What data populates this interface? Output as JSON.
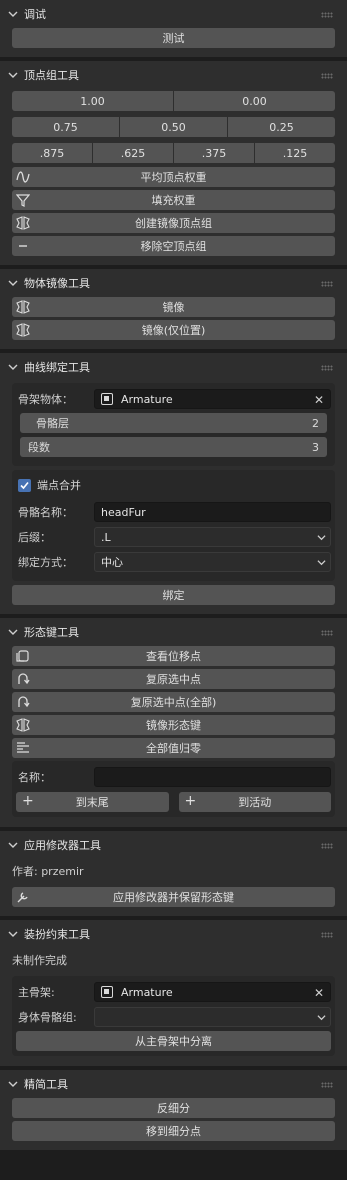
{
  "panels": {
    "debug": {
      "title": "调试",
      "test_label": "测试"
    },
    "vgroup": {
      "title": "顶点组工具",
      "row1": [
        "1.00",
        "0.00"
      ],
      "row2": [
        "0.75",
        "0.50",
        "0.25"
      ],
      "row3": [
        ".875",
        ".625",
        ".375",
        ".125"
      ],
      "avg_label": "平均顶点权重",
      "fill_label": "填充权重",
      "mirror_label": "创建镜像顶点组",
      "remove_label": "移除空顶点组"
    },
    "objmirror": {
      "title": "物体镜像工具",
      "mirror_label": "镜像",
      "mirror_pos_label": "镜像(仅位置)"
    },
    "curve": {
      "title": "曲线绑定工具",
      "armature_label": "骨架物体：",
      "armature_value": "Armature",
      "bone_layer_label": "骨骼层",
      "bone_layer_value": "2",
      "segments_label": "段数",
      "segments_value": "3",
      "merge_label": "端点合并",
      "bone_name_label": "骨骼名称：",
      "bone_name_value": "headFur",
      "suffix_label": "后缀：",
      "suffix_value": ".L",
      "bind_mode_label": "绑定方式：",
      "bind_mode_value": "中心",
      "bind_button": "绑定"
    },
    "shapekey": {
      "title": "形态键工具",
      "view_disp": "查看位移点",
      "restore_sel": "复原选中点",
      "restore_sel_all": "复原选中点(全部)",
      "mirror_shape": "镜像形态键",
      "reset_all": "全部值归零",
      "name_label": "名称：",
      "name_value": "",
      "to_end": "到末尾",
      "to_active": "到活动"
    },
    "modifier": {
      "title": "应用修改器工具",
      "author": "作者: przemir",
      "apply_label": "应用修改器并保留形态键"
    },
    "rig": {
      "title": "装扮约束工具",
      "status": "未制作完成",
      "main_armature_label": "主骨架:",
      "main_armature_value": "Armature",
      "body_group_label": "身体骨骼组:",
      "body_group_value": "",
      "separate_button": "从主骨架中分离"
    },
    "simplify": {
      "title": "精简工具",
      "unsubdiv": "反细分",
      "move_to_subdiv": "移到细分点"
    }
  },
  "colors": {
    "panel_bg": "#2e2e2e",
    "button_bg": "#545454",
    "checkbox_blue": "#4772b3",
    "field_bg": "#1b1b1b"
  }
}
